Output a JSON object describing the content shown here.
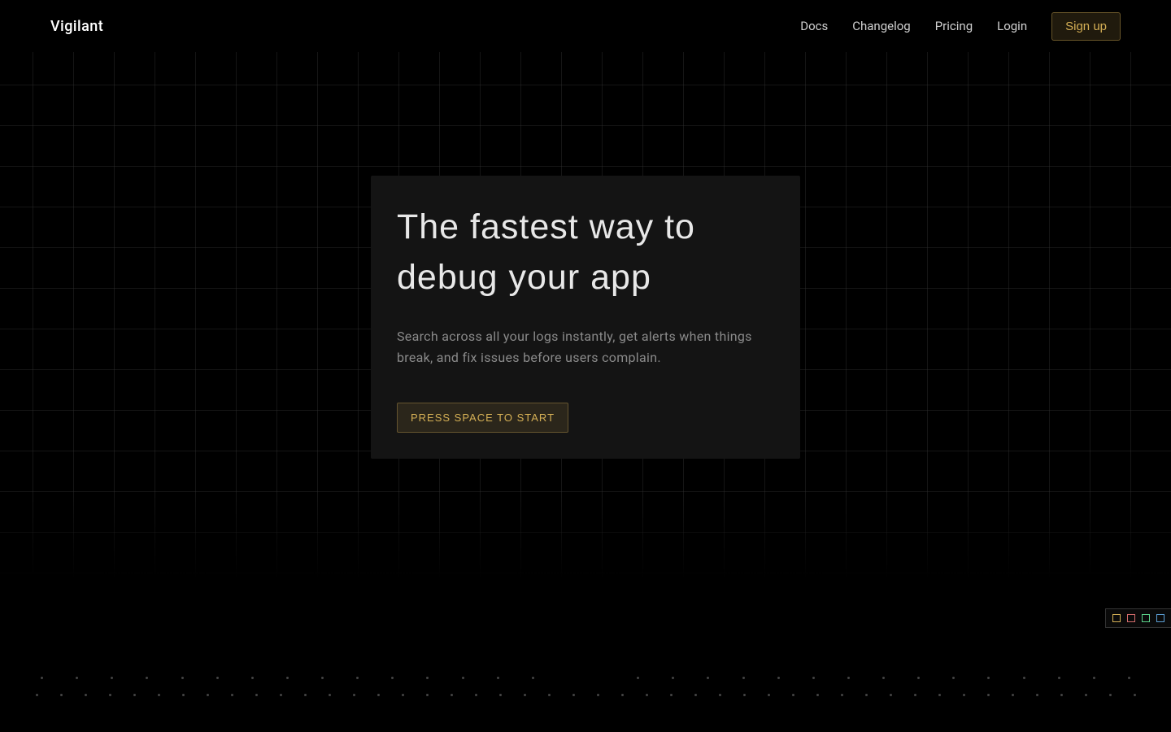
{
  "header": {
    "logo": "Vigilant",
    "nav": {
      "docs": "Docs",
      "changelog": "Changelog",
      "pricing": "Pricing",
      "login": "Login",
      "signup": "Sign up"
    }
  },
  "hero": {
    "title": "The fastest way to debug your app",
    "subtitle": "Search across all your logs instantly, get alerts when things break, and fix issues before users complain.",
    "cta": "PRESS SPACE TO START"
  },
  "color_squares": {
    "colors": [
      "#d4af55",
      "#d46b6b",
      "#5bd48a",
      "#5b9ed4"
    ]
  }
}
